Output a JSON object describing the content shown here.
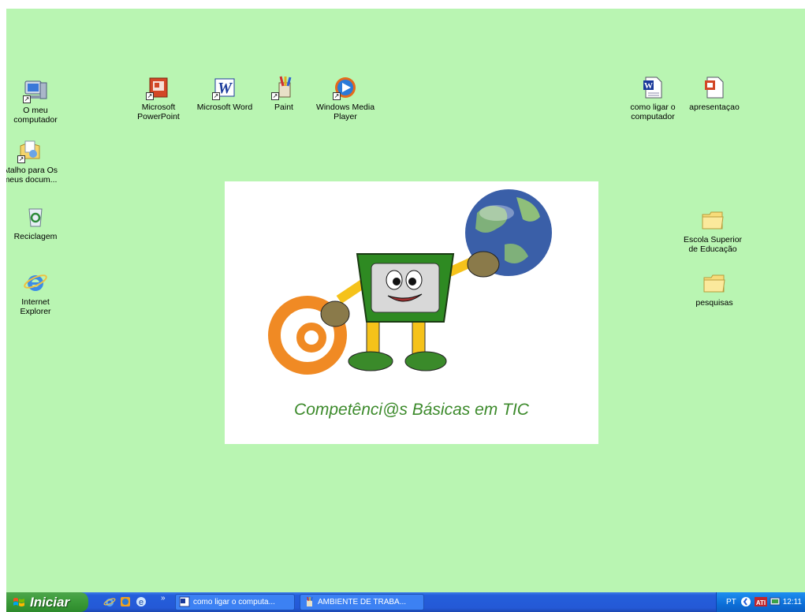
{
  "desktop": {
    "background": "#b9f5b2",
    "icons_left": [
      {
        "label": "O meu computador",
        "icon": "my-computer-icon"
      },
      {
        "label": "Atalho para Os meus docum...",
        "icon": "my-documents-shortcut-icon"
      },
      {
        "label": "Reciclagem",
        "icon": "recycle-bin-icon"
      },
      {
        "label": "Internet Explorer",
        "icon": "internet-explorer-icon"
      }
    ],
    "icons_top": [
      {
        "label": "Microsoft PowerPoint",
        "icon": "powerpoint-icon"
      },
      {
        "label": "Microsoft Word",
        "icon": "word-icon"
      },
      {
        "label": "Paint",
        "icon": "paint-icon"
      },
      {
        "label": "Windows Media Player",
        "icon": "media-player-icon"
      }
    ],
    "icons_right": [
      {
        "label": "como ligar o computador",
        "icon": "word-document-icon"
      },
      {
        "label": "apresentaçao",
        "icon": "powerpoint-document-icon"
      },
      {
        "label": "Escola Superior de Educação",
        "icon": "folder-icon"
      },
      {
        "label": "pesquisas",
        "icon": "folder-icon"
      }
    ],
    "wallpaper": {
      "caption": "Competênci@s Básicas em TIC",
      "caption_color": "#3c8a2b"
    }
  },
  "taskbar": {
    "start_label": "Iniciar",
    "quick_launch": [
      "internet-explorer-icon",
      "media-player-icon",
      "browser-icon"
    ],
    "overflow": "»",
    "buttons": [
      {
        "label": "como ligar o computa...",
        "icon": "word-document-icon"
      },
      {
        "label": "AMBIENTE DE TRABA...",
        "icon": "paint-icon"
      }
    ],
    "tray": {
      "language": "PT",
      "clock": "12:11"
    },
    "colors": {
      "bar": "#245edb",
      "start": "#3a9a38",
      "tray": "#0c6fd8"
    }
  }
}
